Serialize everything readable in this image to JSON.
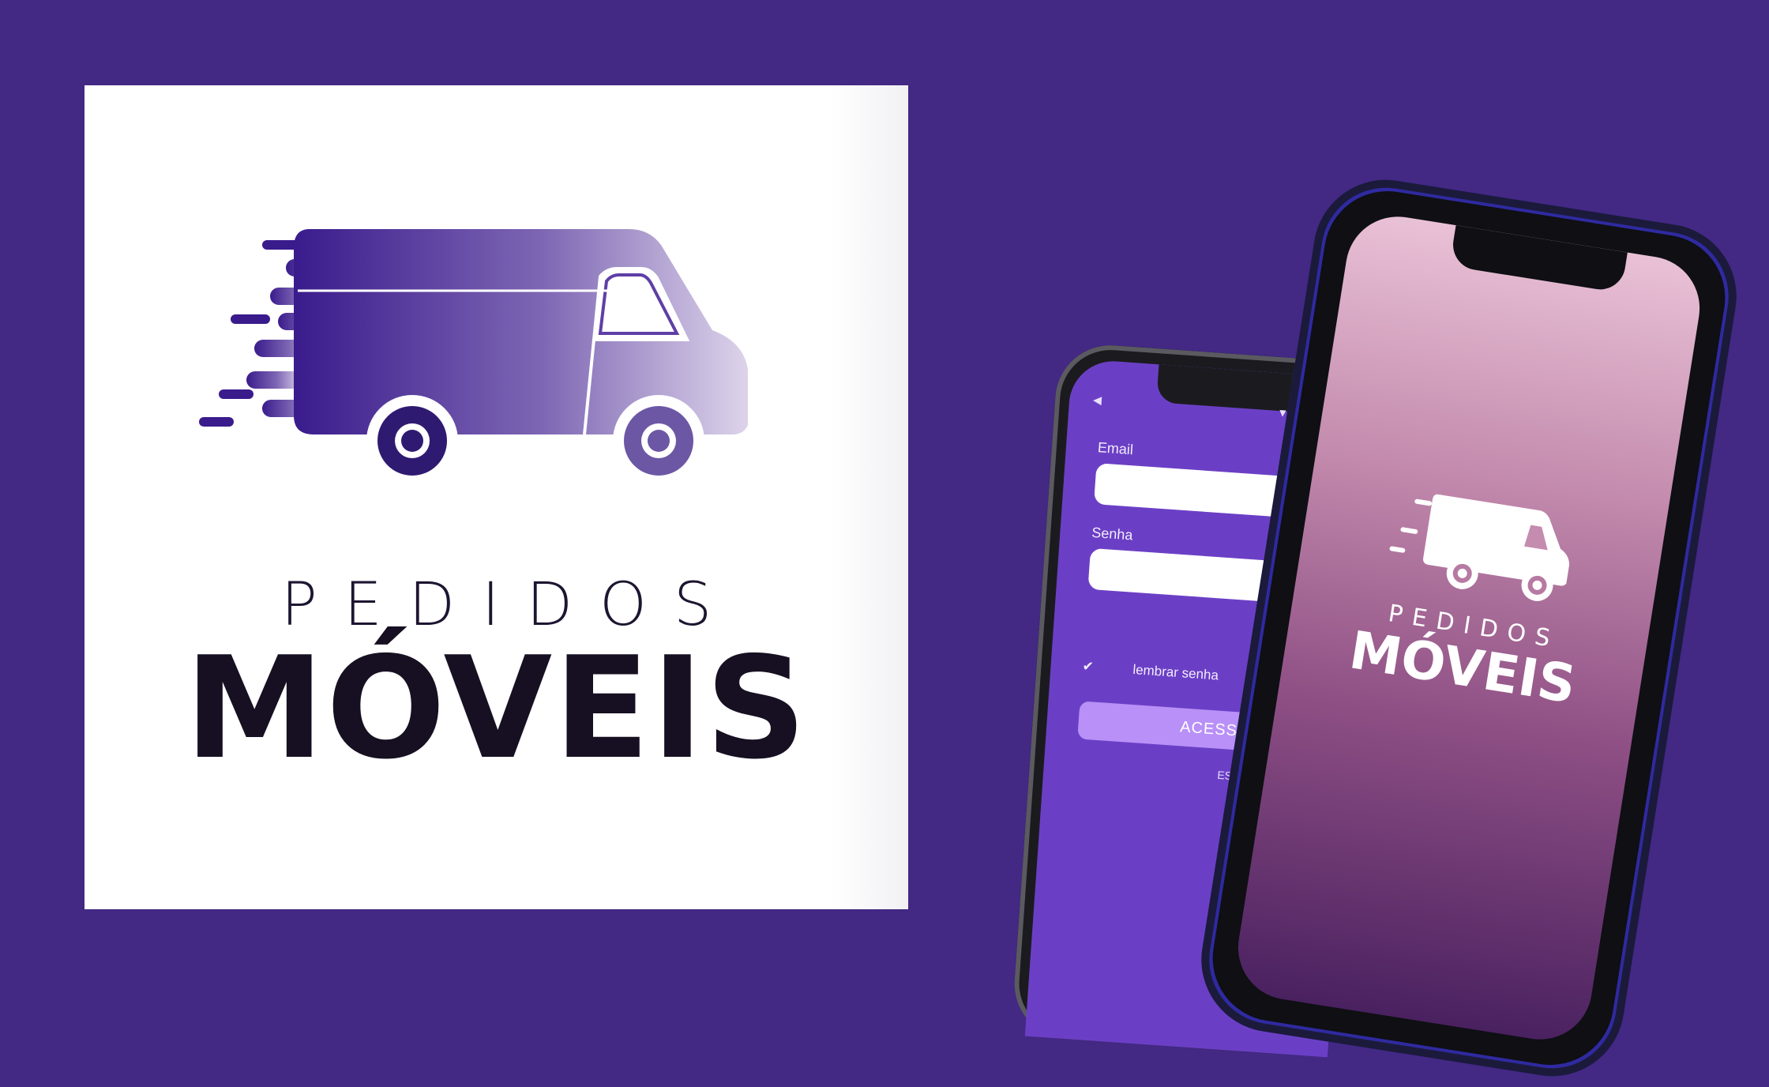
{
  "logo": {
    "brand_top": "PEDIDOS",
    "brand_main": "MÓVEIS",
    "icon": "delivery-van-icon",
    "colors": {
      "van_start": "#3a1b8c",
      "van_end": "#d8cfe8",
      "text": "#171022"
    }
  },
  "login_screen": {
    "email_label": "Email",
    "password_label": "Senha",
    "remember_label": "lembrar senha",
    "submit_label": "ACESSAR",
    "forgot_label": "ESQ",
    "colors": {
      "background": "#6b3fc5",
      "button": "#b990f7"
    }
  },
  "splash_screen": {
    "brand_top": "PEDIDOS",
    "brand_main": "MÓVEIS"
  },
  "background_color": "#432884"
}
